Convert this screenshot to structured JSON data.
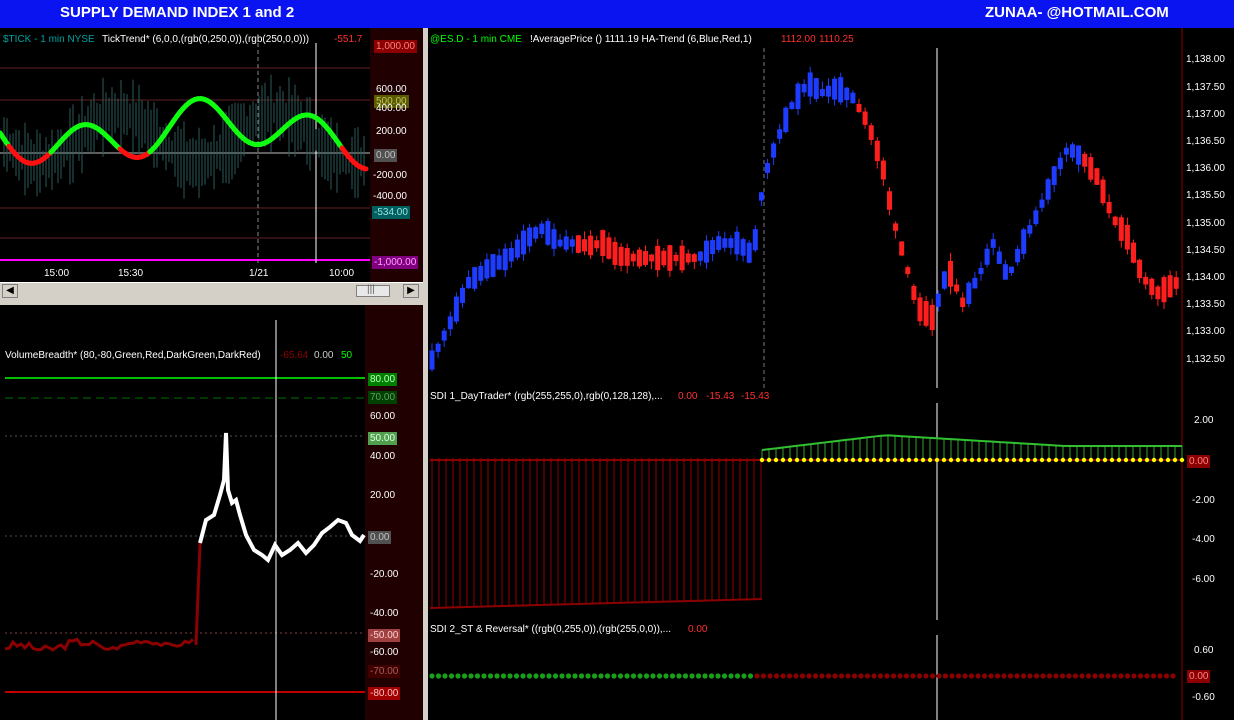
{
  "window": {
    "title": "SUPPLY DEMAND INDEX 1 and 2",
    "contact": "ZUNAA- @HOTMAIL.COM"
  },
  "tick_panel": {
    "symbol": "$TICK - 1 min  NYSE",
    "indicator": "TickTrend* (6,0,0,(rgb(0,250,0)),(rgb(250,0,0)))",
    "value": "-551.7",
    "y_ticks": [
      "1,000.00",
      "600.00",
      "400.00",
      "200.00",
      "0.00",
      "-200.00",
      "-400.00",
      "-534.00",
      "-1,000.00"
    ],
    "x_ticks": [
      "15:00",
      "15:30",
      "1/21",
      "10:00"
    ]
  },
  "breadth_panel": {
    "indicator": "VolumeBreadth* (80,-80,Green,Red,DarkGreen,DarkRed)",
    "values": [
      "-65.64",
      "0.00",
      "50"
    ],
    "y_ticks": [
      "80.00",
      "70.00",
      "60.00",
      "50.00",
      "40.00",
      "20.00",
      "0.00",
      "-20.00",
      "-40.00",
      "-50.00",
      "-60.00",
      "-70.00",
      "-80.00"
    ]
  },
  "es_panel": {
    "symbol": "@ES.D - 1 min  CME",
    "indicator": "!AveragePrice ()  1111.19  HA-Trend (6,Blue,Red,1)",
    "values": [
      "1112.00",
      "1110.25"
    ],
    "y_ticks": [
      "1,138.00",
      "1,137.50",
      "1,137.00",
      "1,136.50",
      "1,136.00",
      "1,135.50",
      "1,135.00",
      "1,134.50",
      "1,134.00",
      "1,133.50",
      "1,133.00",
      "1,132.50"
    ]
  },
  "sdi1_panel": {
    "indicator": "SDI 1_DayTrader* (rgb(255,255,0),rgb(0,128,128),...",
    "values": [
      "0.00",
      "-15.43",
      "-15.43"
    ],
    "y_ticks": [
      "2.00",
      "0.00",
      "-2.00",
      "-4.00",
      "-6.00"
    ]
  },
  "sdi2_panel": {
    "indicator": "SDI 2_ST & Reversal* ((rgb(0,255,0)),(rgb(255,0,0)),...",
    "values": [
      "0.00"
    ],
    "y_ticks": [
      "0.60",
      "0.00",
      "-0.60"
    ]
  },
  "scrollbar": {
    "left_arrow": "◀",
    "right_arrow": "▶",
    "thumb_grip": "|||"
  },
  "colors": {
    "title_bg": "#0a14f0",
    "bull": "#00ff00",
    "bear": "#ff0000",
    "ha_up": "#1e3cff",
    "ha_down": "#ff1e1e"
  }
}
